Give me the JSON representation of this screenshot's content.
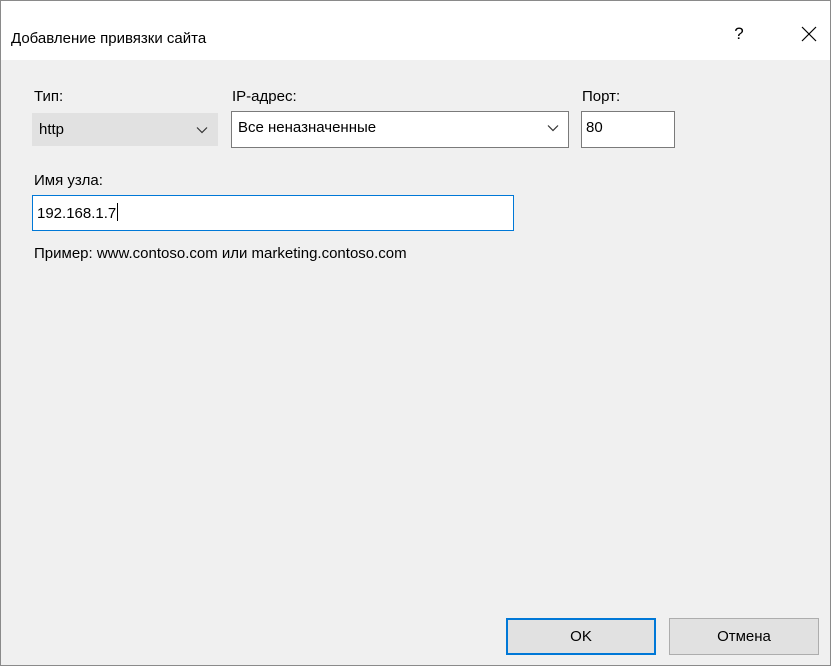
{
  "window": {
    "title": "Добавление привязки сайта",
    "help_label": "?"
  },
  "form": {
    "type_label": "Тип:",
    "type_value": "http",
    "ip_label": "IP-адрес:",
    "ip_value": "Все неназначенные",
    "port_label": "Порт:",
    "port_value": "80",
    "host_label": "Имя узла:",
    "host_value": "192.168.1.7",
    "example_text": "Пример: www.contoso.com или marketing.contoso.com"
  },
  "buttons": {
    "ok_label": "OK",
    "cancel_label": "Отмена"
  },
  "icons": {
    "close": "close-icon",
    "dropdown": "chevron-down-icon"
  },
  "colors": {
    "accent": "#0078d7",
    "dialog_bg": "#f0f0f0",
    "titlebar_bg": "#ffffff",
    "button_bg": "#e1e1e1"
  }
}
